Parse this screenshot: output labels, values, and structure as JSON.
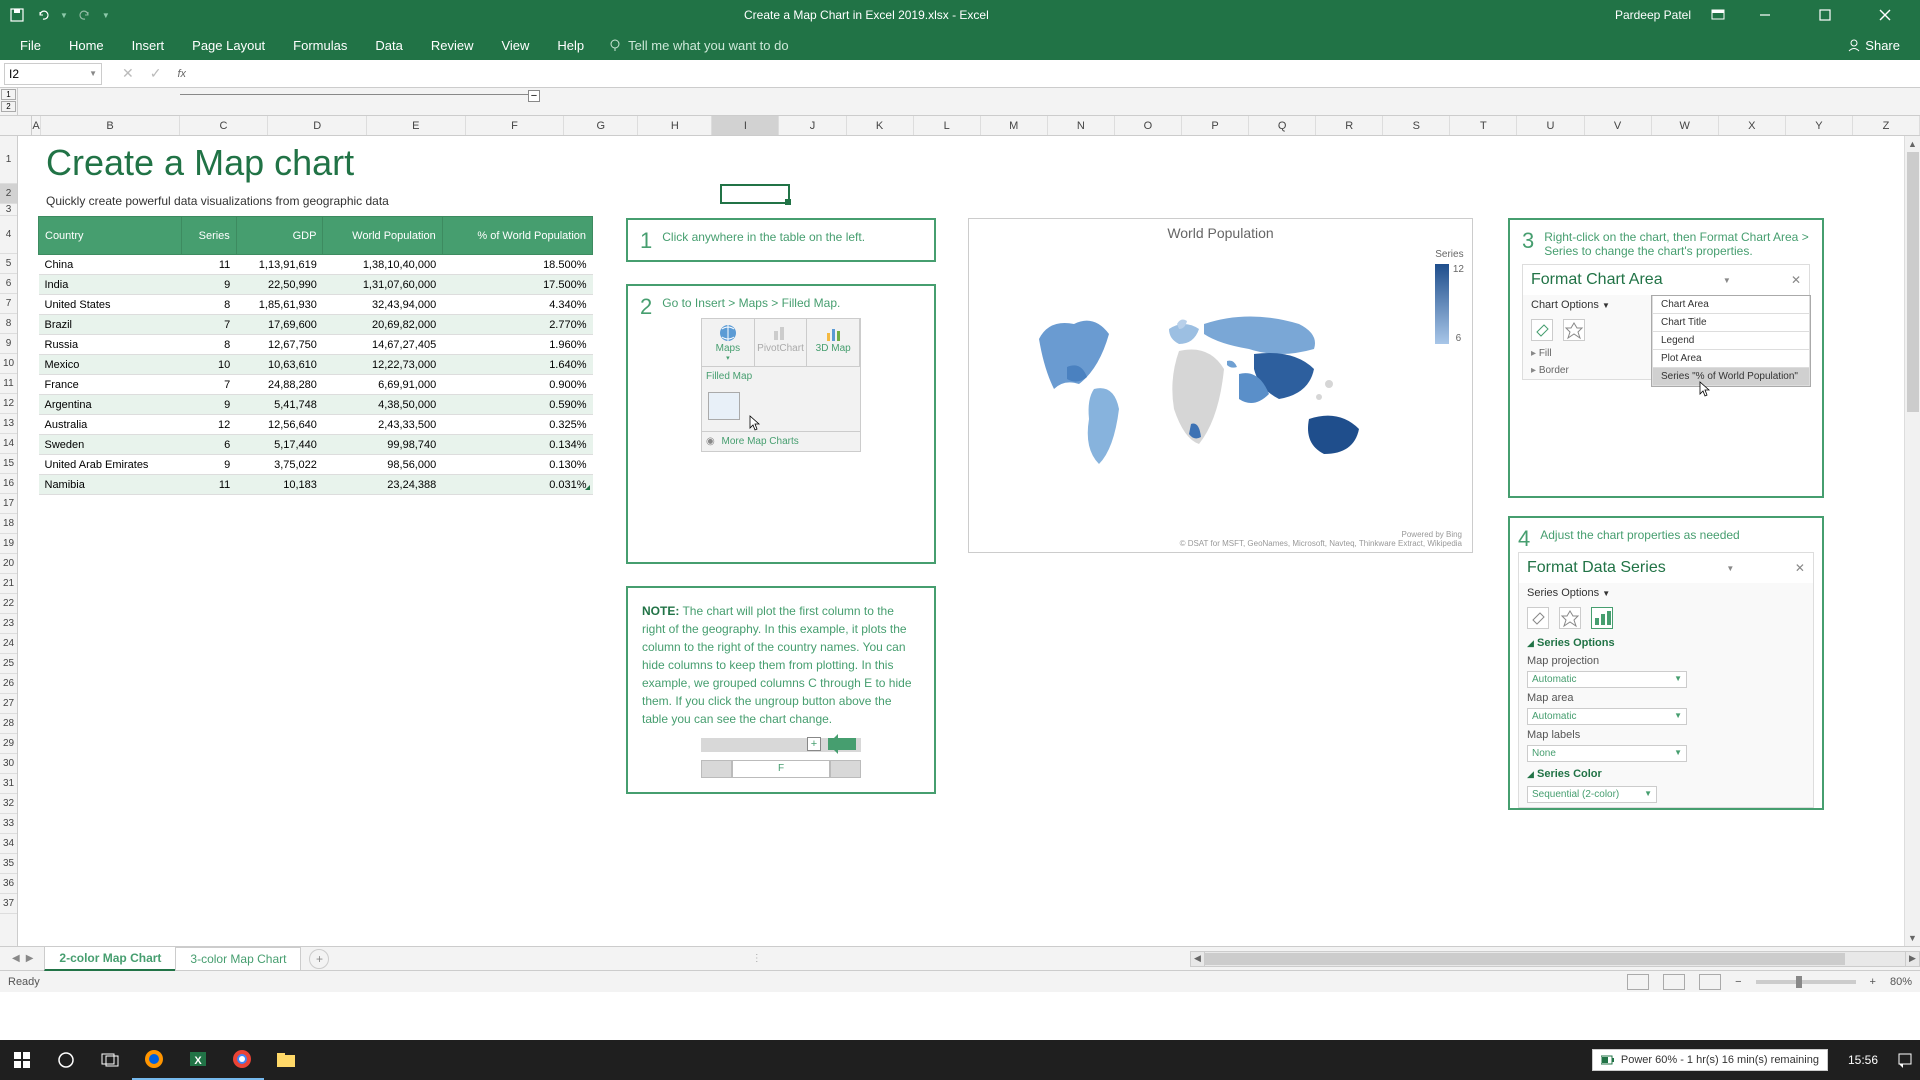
{
  "titlebar": {
    "filename": "Create a Map Chart in Excel 2019.xlsx - Excel",
    "user": "Pardeep Patel"
  },
  "ribbon": {
    "tabs": [
      "File",
      "Home",
      "Insert",
      "Page Layout",
      "Formulas",
      "Data",
      "Review",
      "View",
      "Help"
    ],
    "tell_me": "Tell me what you want to do",
    "share": "Share"
  },
  "formula": {
    "name_box": "I2",
    "fx": "fx"
  },
  "columns": [
    "A",
    "B",
    "C",
    "D",
    "E",
    "F",
    "G",
    "H",
    "I",
    "J",
    "K",
    "L",
    "M",
    "N",
    "O",
    "P",
    "Q",
    "R",
    "S",
    "T",
    "U",
    "V",
    "W",
    "X",
    "Y",
    "Z"
  ],
  "page": {
    "title": "Create a Map chart",
    "subtitle": "Quickly create powerful data visualizations from geographic data"
  },
  "table": {
    "headers": [
      "Country",
      "Series",
      "GDP",
      "World Population",
      "% of World Population"
    ],
    "rows": [
      [
        "China",
        "11",
        "1,13,91,619",
        "1,38,10,40,000",
        "18.500%"
      ],
      [
        "India",
        "9",
        "22,50,990",
        "1,31,07,60,000",
        "17.500%"
      ],
      [
        "United States",
        "8",
        "1,85,61,930",
        "32,43,94,000",
        "4.340%"
      ],
      [
        "Brazil",
        "7",
        "17,69,600",
        "20,69,82,000",
        "2.770%"
      ],
      [
        "Russia",
        "8",
        "12,67,750",
        "14,67,27,405",
        "1.960%"
      ],
      [
        "Mexico",
        "10",
        "10,63,610",
        "12,22,73,000",
        "1.640%"
      ],
      [
        "France",
        "7",
        "24,88,280",
        "6,69,91,000",
        "0.900%"
      ],
      [
        "Argentina",
        "9",
        "5,41,748",
        "4,38,50,000",
        "0.590%"
      ],
      [
        "Australia",
        "12",
        "12,56,640",
        "2,43,33,500",
        "0.325%"
      ],
      [
        "Sweden",
        "6",
        "5,17,440",
        "99,98,740",
        "0.134%"
      ],
      [
        "United Arab Emirates",
        "9",
        "3,75,022",
        "98,56,000",
        "0.130%"
      ],
      [
        "Namibia",
        "11",
        "10,183",
        "23,24,388",
        "0.031%"
      ]
    ]
  },
  "steps": {
    "s1": "Click anywhere in the table on the left.",
    "s2": "Go to Insert > Maps > Filled Map.",
    "s3": "Right-click on the chart, then Format Chart Area > Series to change the chart's properties.",
    "s4": "Adjust the chart properties as needed"
  },
  "map_ribbon": {
    "maps": "Maps",
    "pivot": "PivotChart",
    "map3d": "3D Map",
    "filled": "Filled Map",
    "more": "More Map Charts"
  },
  "note": {
    "label": "NOTE:",
    "text": "The chart will plot the first column to the right of the geography. In this example, it plots the column to the right of the country names. You can hide columns to keep them from plotting. In this example, we grouped columns C through E to hide them. If you click the ungroup button above the table you can see the chart change.",
    "f": "F"
  },
  "chart_data": {
    "type": "map",
    "title": "World Population",
    "legend_label": "Series",
    "scale_max": "12",
    "scale_min": "6",
    "attribution1": "Powered by Bing",
    "attribution2": "© DSAT for MSFT, GeoNames, Microsoft, Navteq, Thinkware Extract, Wikipedia",
    "series": [
      {
        "country": "China",
        "value": 11
      },
      {
        "country": "India",
        "value": 9
      },
      {
        "country": "United States",
        "value": 8
      },
      {
        "country": "Brazil",
        "value": 7
      },
      {
        "country": "Russia",
        "value": 8
      },
      {
        "country": "Mexico",
        "value": 10
      },
      {
        "country": "France",
        "value": 7
      },
      {
        "country": "Argentina",
        "value": 9
      },
      {
        "country": "Australia",
        "value": 12
      },
      {
        "country": "Sweden",
        "value": 6
      },
      {
        "country": "United Arab Emirates",
        "value": 9
      },
      {
        "country": "Namibia",
        "value": 11
      }
    ]
  },
  "format_chart_area": {
    "title": "Format Chart Area",
    "subtitle": "Chart Options",
    "fill": "Fill",
    "border": "Border",
    "dropdown": [
      "Chart Area",
      "Chart Title",
      "Legend",
      "Plot Area",
      "Series \"% of World Population\""
    ]
  },
  "format_data_series": {
    "title": "Format Data Series",
    "subtitle": "Series Options",
    "section": "Series Options",
    "map_projection": "Map projection",
    "map_projection_val": "Automatic",
    "map_area": "Map area",
    "map_area_val": "Automatic",
    "map_labels": "Map labels",
    "map_labels_val": "None",
    "series_color": "Series Color",
    "series_color_val": "Sequential (2-color)"
  },
  "sheet_tabs": {
    "active": "2-color Map Chart",
    "other": "3-color Map Chart"
  },
  "status": {
    "ready": "Ready",
    "zoom": "80%"
  },
  "taskbar": {
    "power": "Power 60% - 1 hr(s) 16 min(s) remaining",
    "time": "15:56"
  }
}
